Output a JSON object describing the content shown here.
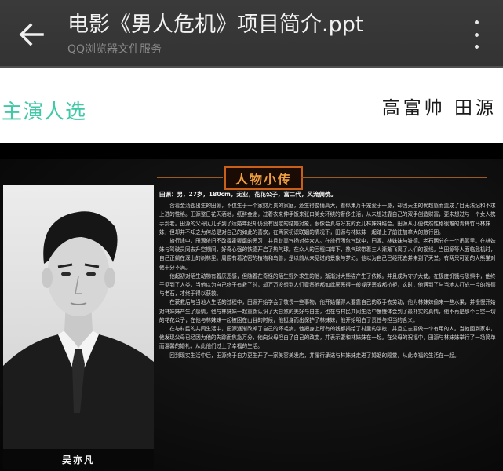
{
  "app_bar": {
    "title": "电影《男人危机》项目简介.ppt",
    "subtitle": "QQ浏览器文件服务",
    "back_icon": "arrow-left-icon",
    "menu_icon": "more-vertical-icon"
  },
  "slide": {
    "section_heading": "主演人选",
    "actor_names": "高富帅 田源",
    "bio_title": "人物小传",
    "photo_caption": "吴亦凡",
    "bio_head": "田源：男，27岁，180cm，无业，花花公子，富二代，风流倜傥。",
    "bio_paragraphs": [
      "含着金汤匙出生的田源，不仅生于一个家财万贯的家庭，还生得俊俏高大，看似集万千宠爱于一身，却因天生的优越感而造成了目无法纪和不求上进的性格。田源整日花天酒地，纸醉金迷，过着衣来伸手饭来张口美女环绕的奢侈生活，从未想过靠自己的双手创造财富，更未想过与一个女人携手到老。田源的父母见儿子到了适婚年纪却仍没有固定的结婚对象，很像会真与好友的女儿林妹妹结合。田源从小便偶然性格很难的青梅竹马林妹妹，但却并不知之为何总是对自己的如此的喜欢，在两家初识联姻的情况下，田源与林妹妹一起踏上了前往加拿大的旅行团。",
      "旅行途中，田源依旧不改挥霍奢靡的恶习，并且趾高气扬对待众人。在旅行团包气球中，田源、林妹妹与铁德、老石两分在一个吊篮里。在林妹妹与驾驶员同去升空期间，好奇心强的铁德开启了热气球。在众人的回程口岸下，热气球带着三人渐渐飞离了人们的视线。当田源等人面临危机时，自己正躺在深山的树林里。周围有着浓密的植物和鸟兽，是以前从未见过的景象与梦幻。他以为自己已经死去并来到了天堂。有两只可爱的大熊猫对他十分不满。",
      "他起初对陌生动物有着厌恶感，但随着在奇怪的陌生野外求生的他，渐渐对大熊猫产生了依赖。并且成为守护大使。在极度饥饿与恐惧中，他终于见到了人类，当他以为自己终于有救了时，却万万没想到人们竟然他都如此厌恶得一般或厌恶或都抗拒，这时，他遇到了与当地人打成一片的铁德与老石，才终于得以获救。",
      "在获救后与当地人生活的过程中，田源开始学会了敬畏一些事物，他开始懂得人要靠自己的双手去劳动，他为林妹妹偷来一些水果，并慢慢开始对林妹妹产生了感情。他与林妹妹一起重新认识了大自然的美好与自由，也在与村民共同生活中慢慢体会到了最朴实的真情，他不再是那个目空一切的花花公子，在他与林妹妹一起被困在山谷的时候，他挺身而出保护了林妹妹，他开始明白了责任与担当的含义。",
      "在与村民的共同生活中，田源逐渐改掉了自己的坏毛病，他把身上所有的钱都捐给了村里的学校，并且立志要做一个有用的人。当他回到家中，他发现父母已经因为他的失踪而焦急万分，他向父母坦白了自己的改变，并表示要和林妹妹在一起。在父母的祝福中，田源与林妹妹举行了一场简单而温馨的婚礼，从此他们过上了幸福的生活。",
      "回到现实生活中后，田源终于自力更生开了一家美容美发店，并履行承诺与林妹妹走进了婚姻的殿堂，从此幸福的生活在一起。"
    ]
  }
}
